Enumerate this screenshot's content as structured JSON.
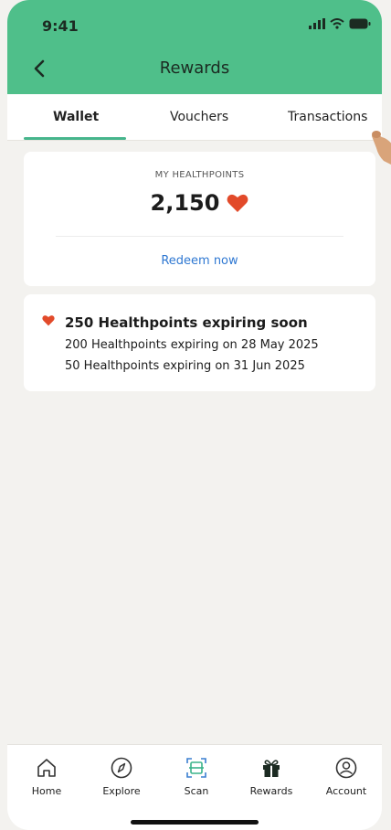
{
  "status_bar": {
    "time": "9:41"
  },
  "header": {
    "title": "Rewards",
    "back_icon": "chevron-left-icon"
  },
  "tabs": [
    {
      "label": "Wallet",
      "active": true
    },
    {
      "label": "Vouchers",
      "active": false
    },
    {
      "label": "Transactions",
      "active": false
    }
  ],
  "points_card": {
    "label": "MY HEALTHPOINTS",
    "value": "2,150",
    "redeem_label": "Redeem now"
  },
  "expiry_card": {
    "title": "250 Healthpoints expiring soon",
    "lines": [
      "200 Healthpoints expiring on 28 May 2025",
      "50 Healthpoints expiring on 31 Jun 2025"
    ]
  },
  "bottom_nav": [
    {
      "label": "Home",
      "icon": "home-icon"
    },
    {
      "label": "Explore",
      "icon": "compass-icon"
    },
    {
      "label": "Scan",
      "icon": "scan-icon"
    },
    {
      "label": "Rewards",
      "icon": "gift-icon"
    },
    {
      "label": "Account",
      "icon": "user-icon"
    }
  ],
  "colors": {
    "header_bg": "#4fbf8a",
    "accent_heart": "#e24a2a",
    "link": "#2f78d2",
    "page_bg": "#f3f2ef"
  }
}
